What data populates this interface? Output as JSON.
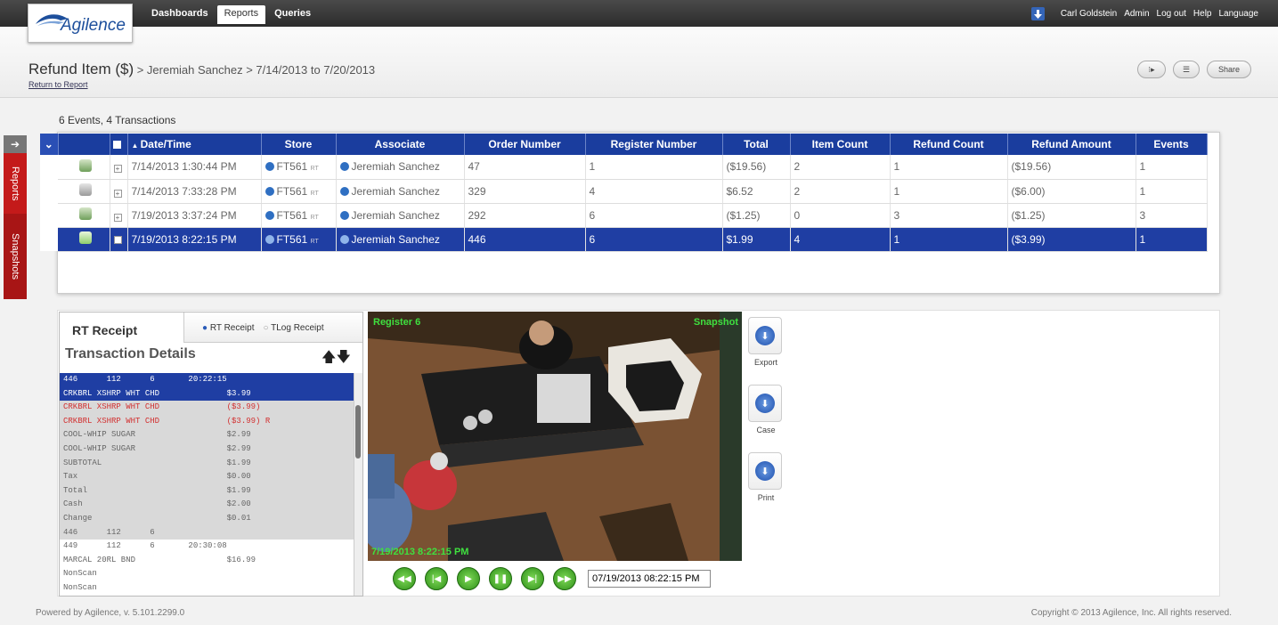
{
  "app": {
    "logo": "Agilence"
  },
  "nav": {
    "items": [
      "Dashboards",
      "Reports",
      "Queries"
    ],
    "active": "Reports"
  },
  "user": {
    "name": "Carl Goldstein",
    "links": [
      "Admin",
      "Log out",
      "Help",
      "Language"
    ]
  },
  "header": {
    "title": "Refund Item ($)",
    "breadcrumb": " > Jeremiah Sanchez > 7/14/2013 to 7/20/2013",
    "return_link": "Return to Report",
    "share": "Share"
  },
  "side_tabs": [
    "Reports",
    "Snapshots"
  ],
  "events": {
    "summary": "6 Events, 4 Transactions",
    "columns": [
      "Date/Time",
      "Store",
      "Associate",
      "Order Number",
      "Register Number",
      "Total",
      "Item Count",
      "Refund Count",
      "Refund Amount",
      "Events"
    ],
    "rows": [
      {
        "datetime": "7/14/2013 1:30:44 PM",
        "store": "FT561",
        "store_tag": "RT",
        "associate": "Jeremiah Sanchez",
        "order": "47",
        "register": "1",
        "total": "($19.56)",
        "item_count": "2",
        "refund_count": "1",
        "refund_amount": "($19.56)",
        "events": "1"
      },
      {
        "datetime": "7/14/2013 7:33:28 PM",
        "store": "FT561",
        "store_tag": "RT",
        "associate": "Jeremiah Sanchez",
        "order": "329",
        "register": "4",
        "total": "$6.52",
        "item_count": "2",
        "refund_count": "1",
        "refund_amount": "($6.00)",
        "events": "1"
      },
      {
        "datetime": "7/19/2013 3:37:24 PM",
        "store": "FT561",
        "store_tag": "RT",
        "associate": "Jeremiah Sanchez",
        "order": "292",
        "register": "6",
        "total": "($1.25)",
        "item_count": "0",
        "refund_count": "3",
        "refund_amount": "($1.25)",
        "events": "3"
      },
      {
        "datetime": "7/19/2013 8:22:15 PM",
        "store": "FT561",
        "store_tag": "RT",
        "associate": "Jeremiah Sanchez",
        "order": "446",
        "register": "6",
        "total": "$1.99",
        "item_count": "4",
        "refund_count": "1",
        "refund_amount": "($3.99)",
        "events": "1"
      }
    ]
  },
  "receipt": {
    "tab": "RT Receipt",
    "radio": [
      "RT Receipt",
      "TLog Receipt"
    ],
    "title": "Transaction Details",
    "lines": [
      {
        "text": "446      112      6       20:22:15",
        "style": "blue"
      },
      {
        "text": "CRKBRL XSHRP WHT CHD              $3.99",
        "style": "blue"
      },
      {
        "text": "CRKBRL XSHRP WHT CHD              ($3.99)",
        "style": "red"
      },
      {
        "text": "CRKBRL XSHRP WHT CHD              ($3.99) R",
        "style": "red"
      },
      {
        "text": "COOL-WHIP SUGAR                   $2.99",
        "style": "grey"
      },
      {
        "text": "COOL-WHIP SUGAR                   $2.99",
        "style": "grey"
      },
      {
        "text": "SUBTOTAL                          $1.99",
        "style": "grey"
      },
      {
        "text": "Tax                               $0.00",
        "style": "grey"
      },
      {
        "text": "Total                             $1.99",
        "style": "grey"
      },
      {
        "text": "Cash                              $2.00",
        "style": "grey"
      },
      {
        "text": "Change                            $0.01",
        "style": "grey"
      },
      {
        "text": "446      112      6",
        "style": "grey"
      },
      {
        "text": "449      112      6       20:30:08",
        "style": "white"
      },
      {
        "text": "MARCAL 20RL BND                   $16.99",
        "style": "white"
      },
      {
        "text": "NonScan",
        "style": "white"
      },
      {
        "text": "NonScan",
        "style": "white"
      }
    ]
  },
  "video": {
    "top_left": "Register 6",
    "top_right": "Snapshot",
    "timestamp_overlay": "7/19/2013 8:22:15 PM",
    "timestamp_field": "07/19/2013 08:22:15 PM"
  },
  "actions": [
    "Export",
    "Case",
    "Print"
  ],
  "footer": {
    "left": "Powered by Agilence, v. 5.101.2299.0",
    "right": "Copyright © 2013 Agilence, Inc. All rights reserved."
  }
}
